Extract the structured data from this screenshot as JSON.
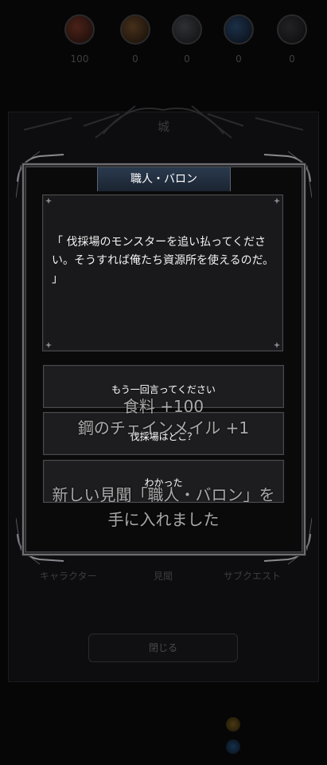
{
  "resources": [
    {
      "icon": "red-orb-icon",
      "value": "100",
      "color": "#3a1a14"
    },
    {
      "icon": "orange-orb-icon",
      "value": "0",
      "color": "#3a2514"
    },
    {
      "icon": "grey-orb-icon",
      "value": "0",
      "color": "#222428"
    },
    {
      "icon": "blue-orb-icon",
      "value": "0",
      "color": "#14243a"
    },
    {
      "icon": "dark-orb-icon",
      "value": "0",
      "color": "#1a1a1c"
    }
  ],
  "background": {
    "panel_title": "城",
    "tabs": [
      "キャラクター",
      "見聞",
      "サブクエスト"
    ],
    "close_label": "閉じる"
  },
  "dialog": {
    "speaker": "職人・バロン",
    "speech": "「 伐採場のモンスターを追い払ってください。そうすれば俺たち資源所を使えるのだ。 」",
    "choices": [
      "もう一回言ってください",
      "伐採場はどこ？",
      "わかった"
    ]
  },
  "rewards": {
    "line1": "食料 +100",
    "line2": "鋼のチェインメイル +1",
    "line3": "新しい見聞「職人・バロン」を",
    "line4": "手に入れました"
  },
  "colors": {
    "title_bar": "#24303f",
    "frame": "#6d6d72",
    "background": "#060607"
  }
}
